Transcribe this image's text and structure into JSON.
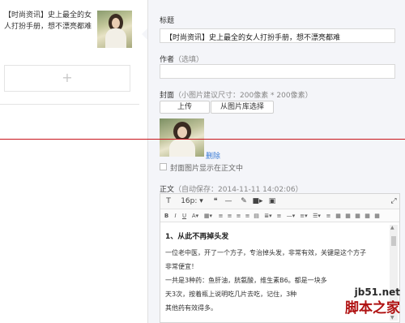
{
  "list": {
    "article_title": "【时尚资讯】史上最全的女人打扮手册，想不漂亮都难",
    "add_icon": "+"
  },
  "form": {
    "title_label": "标题",
    "title_value": "【时尚资讯】史上最全的女人打扮手册，想不漂亮都难",
    "author_label": "作者",
    "author_hint": "（选填）",
    "author_value": "",
    "cover_label": "封面",
    "cover_hint": "（小图片建议尺寸：200像素 * 200像素）",
    "upload_button": "上传",
    "library_button": "从图片库选择",
    "delete_link": "删除",
    "show_cover_label": "封面图片显示在正文中",
    "body_label": "正文",
    "body_hint": "（自动保存：2014-11-11 14:02:06）"
  },
  "editor": {
    "toolbar_row1": {
      "format": "T",
      "font_size": "16p: ▾",
      "quote": "❝",
      "hr": "—",
      "brush": "✎",
      "video": "■▸",
      "image": "▣",
      "fullscreen": "⤢"
    },
    "toolbar_row2": [
      "B",
      "I",
      "U",
      "A▾",
      "▦▾",
      "≡",
      "≡",
      "≡",
      "≡",
      "▤",
      "≣▾",
      "≡",
      "—▾",
      "≡▾",
      "☰▾",
      "≡",
      "▦",
      "▦",
      "▦",
      "▦",
      "▦"
    ],
    "heading": "1、从此不再掉头发",
    "paragraphs": [
      "一位老中医，开了一个方子，专治掉头发，非常有效，关键是这个方子",
      "非常便宜！",
      "一共是3种药：鱼肝油，胱氨酸，维生素B6。都是一块多",
      "天3次，按着瓶上说明吃几片去吃，记住，3种",
      "其他药有效得多。"
    ]
  },
  "watermark": {
    "url": "jb51.net",
    "name": "脚本之家"
  },
  "colors": {
    "panel_bg": "#f4f5f9",
    "guide_line": "#c8151c",
    "link": "#3a7bd5",
    "watermark_red": "#b01212"
  }
}
